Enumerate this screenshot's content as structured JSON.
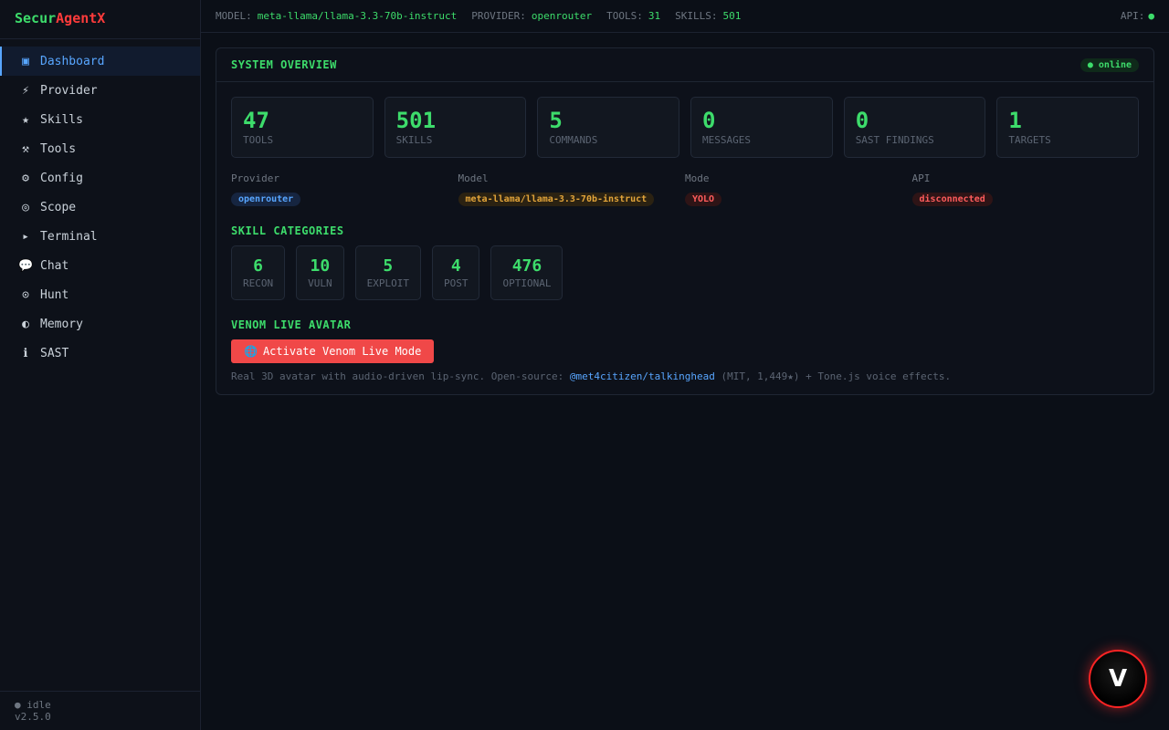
{
  "logo": {
    "part1": "Secur",
    "part2": "AgentX"
  },
  "nav": [
    {
      "icon": "▣",
      "label": "Dashboard",
      "icon_name": "dashboard-icon"
    },
    {
      "icon": "⚡",
      "label": "Provider",
      "icon_name": "lightning-icon"
    },
    {
      "icon": "★",
      "label": "Skills",
      "icon_name": "star-icon"
    },
    {
      "icon": "⚒",
      "label": "Tools",
      "icon_name": "hammer-icon"
    },
    {
      "icon": "⚙",
      "label": "Config",
      "icon_name": "gear-icon"
    },
    {
      "icon": "◎",
      "label": "Scope",
      "icon_name": "target-icon"
    },
    {
      "icon": "▸",
      "label": "Terminal",
      "icon_name": "terminal-icon"
    },
    {
      "icon": "💬",
      "label": "Chat",
      "icon_name": "chat-icon"
    },
    {
      "icon": "⊙",
      "label": "Hunt",
      "icon_name": "crosshair-icon"
    },
    {
      "icon": "◐",
      "label": "Memory",
      "icon_name": "memory-icon"
    },
    {
      "icon": "ℹ",
      "label": "SAST",
      "icon_name": "info-icon"
    }
  ],
  "footer": {
    "status": "● idle",
    "version": "v2.5.0"
  },
  "topbar": {
    "model_key": "MODEL:",
    "model_val": "meta-llama/llama-3.3-70b-instruct",
    "provider_key": "PROVIDER:",
    "provider_val": "openrouter",
    "tools_key": "TOOLS:",
    "tools_val": "31",
    "skills_key": "SKILLS:",
    "skills_val": "501",
    "api_key": "API:",
    "api_dot": "●"
  },
  "overview": {
    "title": "SYSTEM OVERVIEW",
    "badge": "● online",
    "stats": [
      {
        "value": "47",
        "label": "TOOLS"
      },
      {
        "value": "501",
        "label": "SKILLS"
      },
      {
        "value": "5",
        "label": "COMMANDS"
      },
      {
        "value": "0",
        "label": "MESSAGES"
      },
      {
        "value": "0",
        "label": "SAST FINDINGS"
      },
      {
        "value": "1",
        "label": "TARGETS"
      }
    ],
    "info": {
      "provider_label": "Provider",
      "provider_value": "openrouter",
      "model_label": "Model",
      "model_value": "meta-llama/llama-3.3-70b-instruct",
      "mode_label": "Mode",
      "mode_value": "YOLO",
      "api_label": "API",
      "api_value": "disconnected"
    },
    "categories_title": "SKILL CATEGORIES",
    "categories": [
      {
        "value": "6",
        "label": "RECON"
      },
      {
        "value": "10",
        "label": "VULN"
      },
      {
        "value": "5",
        "label": "EXPLOIT"
      },
      {
        "value": "4",
        "label": "POST"
      },
      {
        "value": "476",
        "label": "OPTIONAL"
      }
    ],
    "venom_title": "VENOM LIVE AVATAR",
    "venom_button": "Activate Venom Live Mode",
    "desc_prefix": "Real 3D avatar with audio-driven lip-sync. Open-source: ",
    "desc_link": "@met4citizen/talkinghead",
    "desc_suffix": " (MIT, 1,449★) + Tone.js voice effects."
  },
  "fab": {
    "letter": "V"
  },
  "colors": {
    "accent_green": "#3ddc6b",
    "accent_blue": "#58a6ff",
    "accent_red": "#f04848",
    "bg": "#0b0f17"
  }
}
